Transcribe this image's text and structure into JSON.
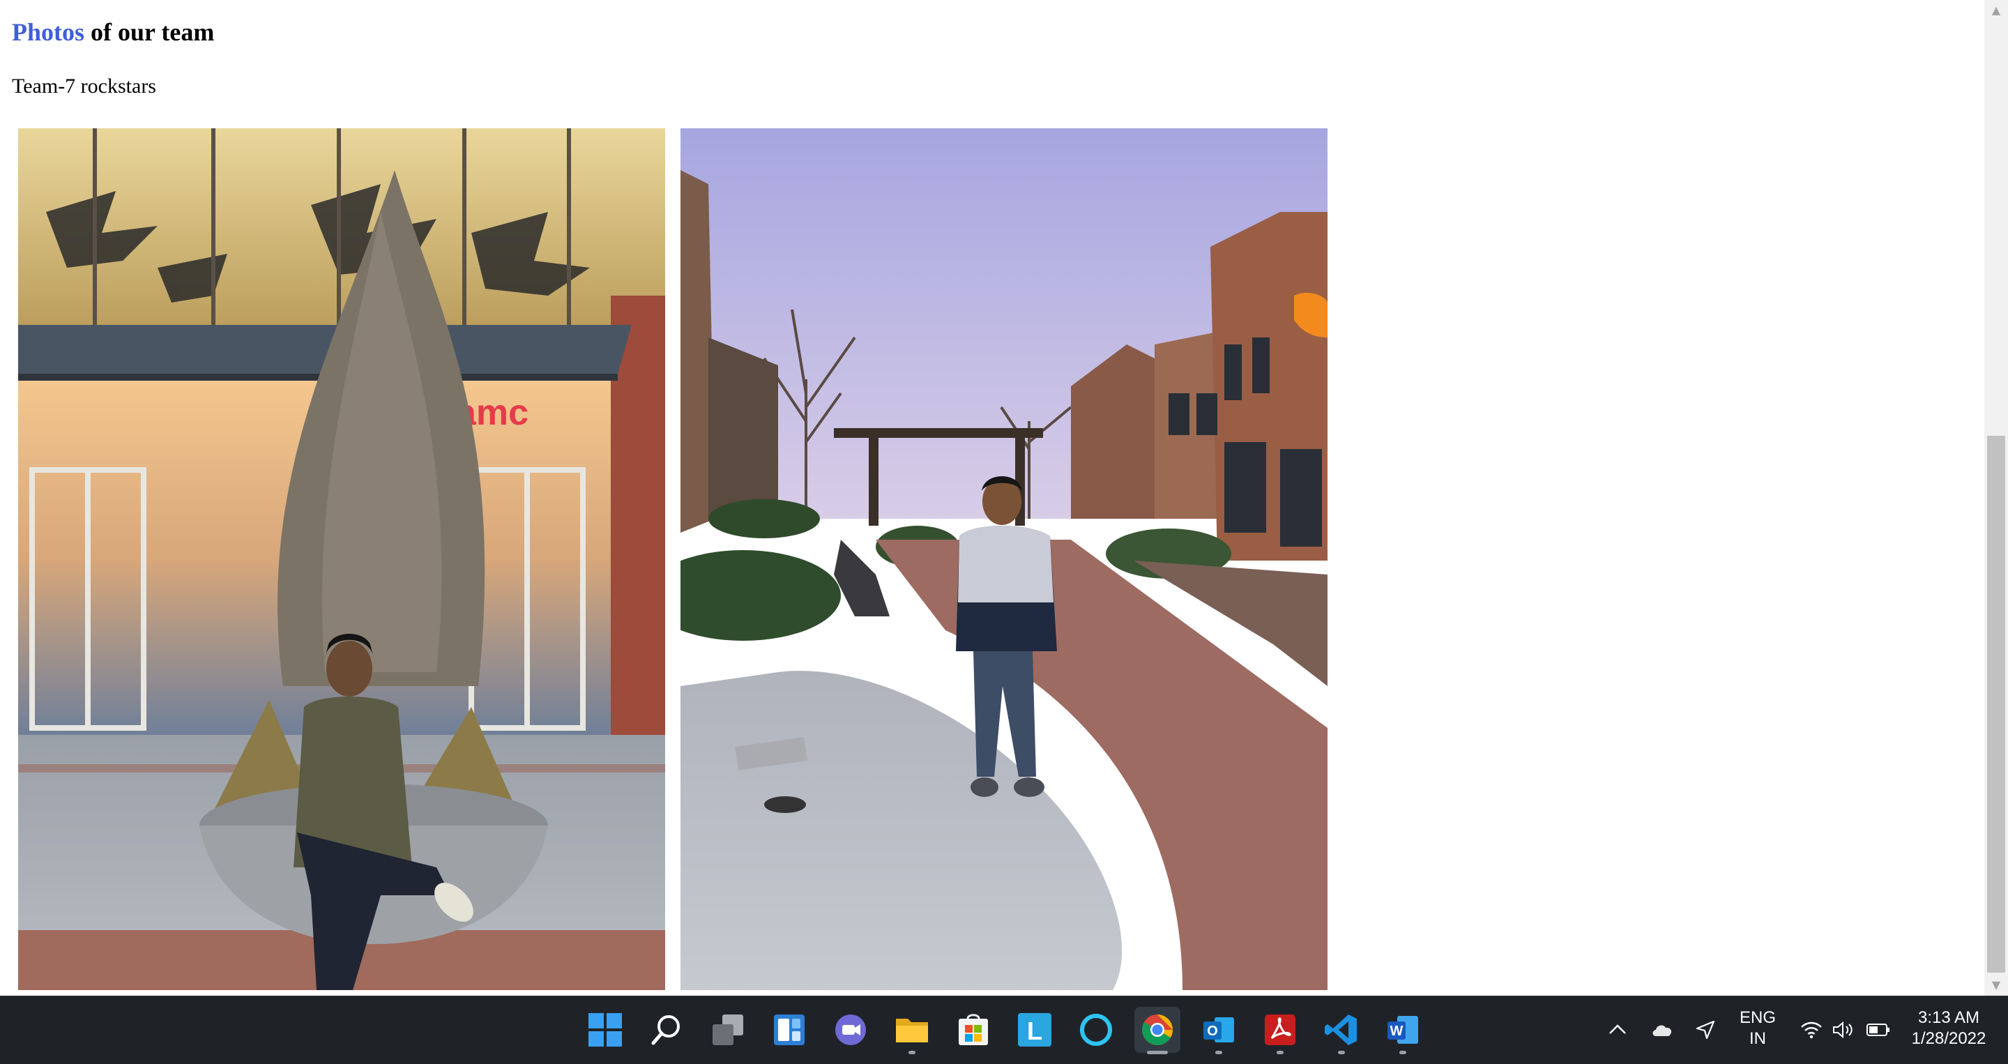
{
  "page": {
    "heading_accent": "Photos",
    "heading_rest": " of our team",
    "subtitle": "Team-7 rockstars"
  },
  "photos": [
    {
      "subject": "team member seated on planter outside cinema",
      "sign_text": "amc"
    },
    {
      "subject": "team member standing on outdoor shopping street path"
    }
  ],
  "taskbar": {
    "apps": [
      {
        "name": "start",
        "icon": "windows-logo-icon"
      },
      {
        "name": "search",
        "icon": "search-icon"
      },
      {
        "name": "task-view",
        "icon": "task-view-icon"
      },
      {
        "name": "widgets",
        "icon": "widgets-icon"
      },
      {
        "name": "teams-chat",
        "icon": "video-chat-icon"
      },
      {
        "name": "file-explorer",
        "icon": "folder-icon"
      },
      {
        "name": "store",
        "icon": "store-icon"
      },
      {
        "name": "lens-app",
        "icon": "l-app-icon",
        "letter": "L"
      },
      {
        "name": "alexa",
        "icon": "ring-icon"
      },
      {
        "name": "chrome",
        "icon": "chrome-icon",
        "active": true
      },
      {
        "name": "outlook",
        "icon": "outlook-icon",
        "letter": "O"
      },
      {
        "name": "acrobat",
        "icon": "acrobat-icon"
      },
      {
        "name": "vscode",
        "icon": "vscode-icon"
      },
      {
        "name": "word",
        "icon": "word-icon",
        "letter": "W"
      }
    ],
    "tray": {
      "language_line1": "ENG",
      "language_line2": "IN",
      "time": "3:13 AM",
      "date": "1/28/2022"
    }
  },
  "colors": {
    "accent": "#3f5fd8",
    "taskbar_bg": "#1f2328"
  }
}
